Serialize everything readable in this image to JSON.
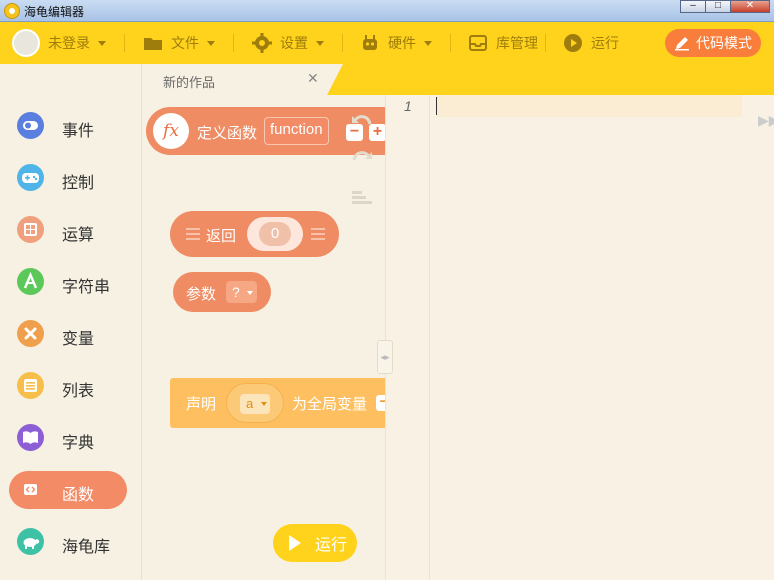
{
  "window": {
    "title": "海龟编辑器"
  },
  "toolbar": {
    "login": "未登录",
    "file": "文件",
    "settings": "设置",
    "hardware": "硬件",
    "library": "库管理",
    "run": "运行",
    "code_mode": "代码模式"
  },
  "tab": {
    "label": "新的作品",
    "close": "✕"
  },
  "categories": [
    {
      "label": "事件",
      "color": "#5b7fe0"
    },
    {
      "label": "控制",
      "color": "#4fb4e8"
    },
    {
      "label": "运算",
      "color": "#f0a07c"
    },
    {
      "label": "字符串",
      "color": "#5cc85a"
    },
    {
      "label": "变量",
      "color": "#f0a04c"
    },
    {
      "label": "列表",
      "color": "#f7be4a"
    },
    {
      "label": "字典",
      "color": "#8d5fd6"
    },
    {
      "label": "函数",
      "color": "#f28b66"
    },
    {
      "label": "海龟库",
      "color": "#3ec2a6"
    }
  ],
  "blocks": {
    "define_function": {
      "label": "定义函数",
      "name": "function",
      "minus": "−",
      "plus": "+",
      "fx": "fx"
    },
    "return": {
      "label": "返回",
      "value": "0"
    },
    "param": {
      "label": "参数",
      "value": "?"
    },
    "declare": {
      "label": "声明",
      "value": "a",
      "suffix": "为全局变量"
    }
  },
  "editor": {
    "line_number": "1"
  },
  "run_button": {
    "label": "运行"
  }
}
